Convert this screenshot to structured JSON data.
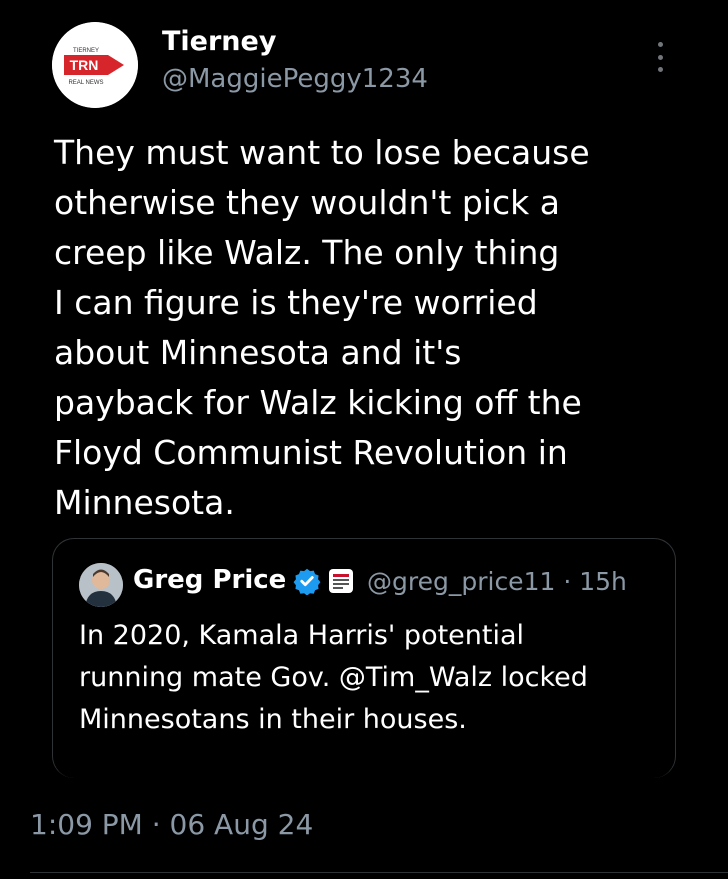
{
  "author": {
    "display_name": "Tierney",
    "handle": "@MaggiePeggy1234",
    "avatar_logo_text": "TRN",
    "avatar_logo_top": "TIERNEY",
    "avatar_logo_bottom": "REAL NEWS"
  },
  "tweet": {
    "text": "They must want to lose because\notherwise they wouldn't pick a\ncreep like Walz. The only thing\nI can figure is they're worried\nabout Minnesota and it's\npayback for Walz kicking off the\nFloyd Communist Revolution in\nMinnesota.",
    "timestamp": "1:09 PM · 06 Aug 24"
  },
  "quote": {
    "display_name": "Greg Price",
    "handle_time": "@greg_price11 · 15h",
    "text": "In 2020, Kamala Harris' potential\nrunning mate Gov. @Tim_Walz locked\nMinnesotans in their houses."
  },
  "icons": {
    "more": "more-vertical-icon",
    "verified": "verified-badge-icon",
    "affiliation": "affiliation-badge-icon"
  },
  "colors": {
    "background": "#000000",
    "text": "#ffffff",
    "secondary": "#8b98a5",
    "verified": "#1d9bf0",
    "logo_red": "#d7262b"
  }
}
